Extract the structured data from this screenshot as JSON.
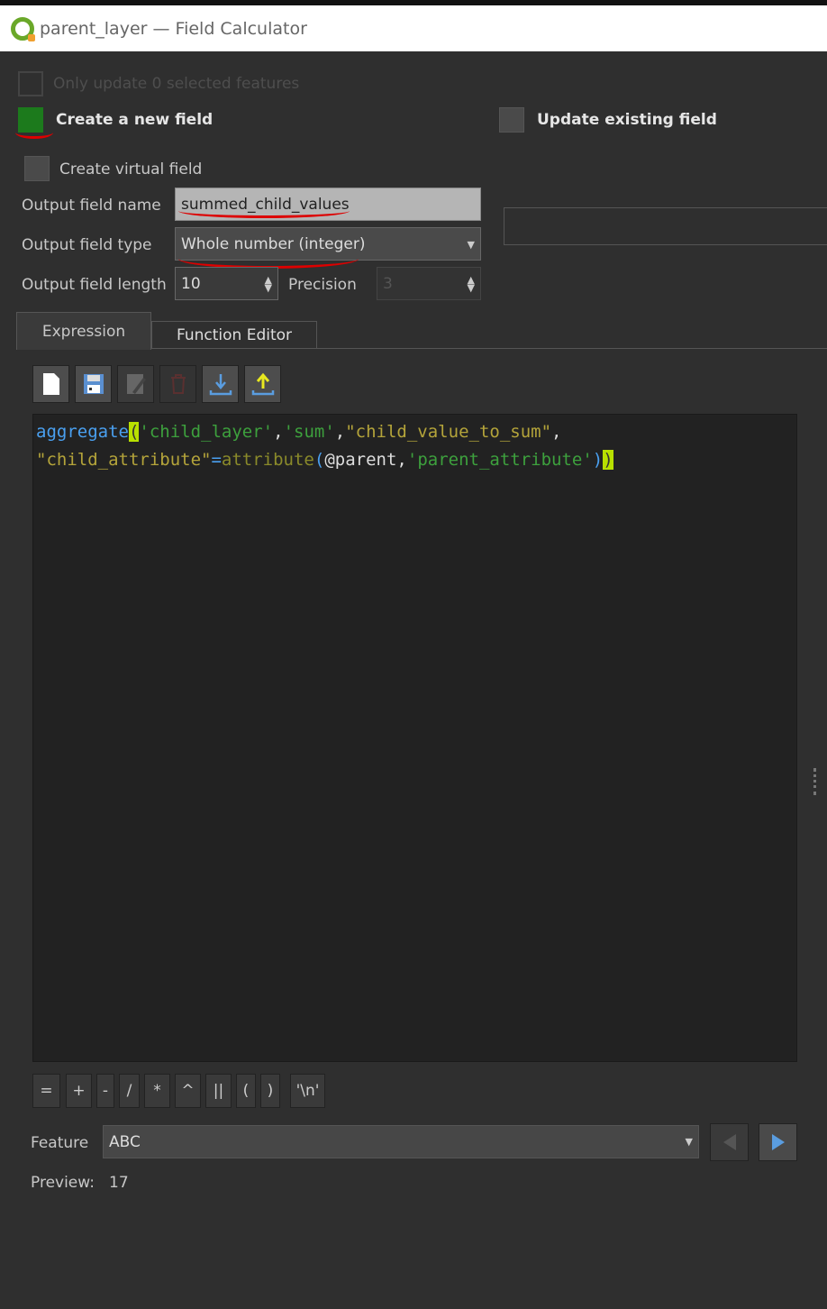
{
  "window": {
    "title": "parent_layer — Field Calculator"
  },
  "options": {
    "only_selected": "Only update 0 selected features",
    "create_new_field": "Create a new field",
    "update_existing_field": "Update existing field",
    "create_virtual_field": "Create virtual field",
    "output_field_name_label": "Output field name",
    "output_field_name_value": "summed_child_values",
    "output_field_type_label": "Output field type",
    "output_field_type_value": "Whole number (integer)",
    "output_field_length_label": "Output field length",
    "output_field_length_value": "10",
    "precision_label": "Precision",
    "precision_value": "3"
  },
  "tabs": [
    {
      "label": "Expression",
      "active": true
    },
    {
      "label": "Function Editor",
      "active": false
    }
  ],
  "toolbar": [
    "new-file-icon",
    "save-icon",
    "edit-icon",
    "delete-icon",
    "import-icon",
    "export-icon"
  ],
  "expression": {
    "line1": [
      {
        "t": "aggregate",
        "c": "k"
      },
      {
        "t": "(",
        "c": "hl"
      },
      {
        "t": "'child_layer'",
        "c": "s"
      },
      {
        "t": ",",
        "c": "w"
      },
      {
        "t": "'sum'",
        "c": "s"
      },
      {
        "t": ",",
        "c": "w"
      },
      {
        "t": "\"child_value_to_sum\"",
        "c": "f"
      },
      {
        "t": ",",
        "c": "w"
      }
    ],
    "line2": [
      {
        "t": "\"child_attribute\"",
        "c": "f"
      },
      {
        "t": "=",
        "c": "p"
      },
      {
        "t": "attribute",
        "c": "o"
      },
      {
        "t": "(",
        "c": "p"
      },
      {
        "t": "@",
        "c": "w"
      },
      {
        "t": "parent",
        "c": "w"
      },
      {
        "t": ",",
        "c": "w"
      },
      {
        "t": "'parent_attribute'",
        "c": "s"
      },
      {
        "t": ")",
        "c": "p"
      },
      {
        "t": ")",
        "c": "hl"
      }
    ]
  },
  "operators": [
    "=",
    "+",
    "-",
    "/",
    "*",
    "^",
    "||",
    "(",
    ")",
    "'\\n'"
  ],
  "feature": {
    "label": "Feature",
    "value": "ABC"
  },
  "preview": {
    "label": "Preview:",
    "value": "17"
  }
}
